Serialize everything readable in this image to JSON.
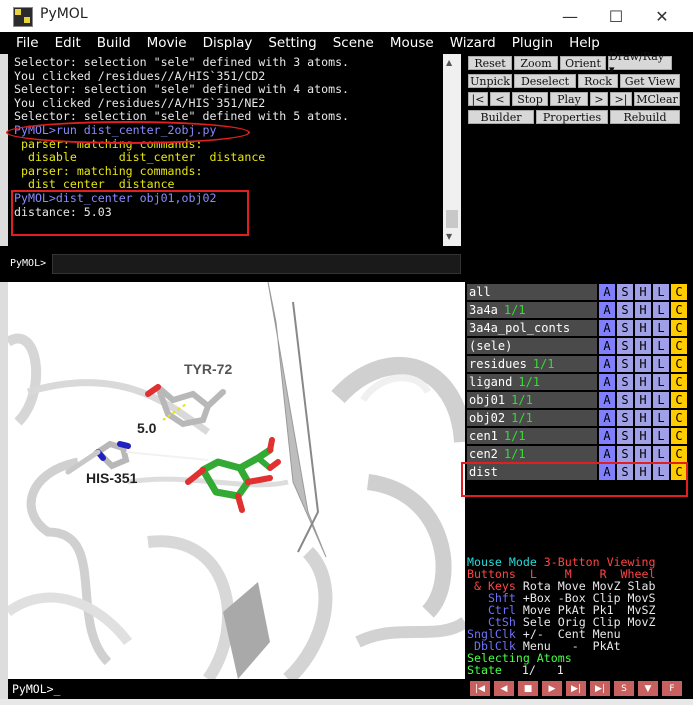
{
  "window": {
    "title": "PyMOL",
    "minimize": "—",
    "maximize": "☐",
    "close": "✕"
  },
  "menu": [
    "File",
    "Edit",
    "Build",
    "Movie",
    "Display",
    "Setting",
    "Scene",
    "Mouse",
    "Wizard",
    "Plugin",
    "Help"
  ],
  "console": {
    "lines": [
      {
        "text": "Selector: selection \"sele\" defined with 3 atoms.",
        "color": "white"
      },
      {
        "text": "You clicked /residues//A/HIS`351/CD2",
        "color": "white"
      },
      {
        "text": "Selector: selection \"sele\" defined with 4 atoms.",
        "color": "white"
      },
      {
        "text": "You clicked /residues//A/HIS`351/NE2",
        "color": "white"
      },
      {
        "text": "Selector: selection \"sele\" defined with 5 atoms.",
        "color": "white"
      },
      {
        "text": "PyMOL>run dist_center_2obj.py",
        "color": "blue"
      },
      {
        "text": " parser: matching commands:",
        "color": "yellow"
      },
      {
        "text": "  disable      dist_center  distance",
        "color": "yellow"
      },
      {
        "text": " parser: matching commands:",
        "color": "yellow"
      },
      {
        "text": "  dist_center  distance",
        "color": "yellow"
      },
      {
        "text": "PyMOL>dist_center obj01,obj02",
        "color": "blue"
      },
      {
        "text": "distance: 5.03",
        "color": "white"
      }
    ]
  },
  "control_buttons": {
    "row1": [
      "Reset",
      "Zoom",
      "Orient",
      "Draw/Ray ▾"
    ],
    "row2": [
      "Unpick",
      "Deselect",
      "Rock",
      "Get View"
    ],
    "row3": [
      "|<",
      "<",
      "Stop",
      "Play",
      ">",
      ">|",
      "MClear"
    ],
    "row4": [
      "Builder",
      "Properties",
      "Rebuild"
    ]
  },
  "command_line": {
    "label": "PyMOL>",
    "value": ""
  },
  "viewer": {
    "labels": {
      "tyr": "TYR-72",
      "his": "HIS-351",
      "distance": "5.0"
    }
  },
  "objects": [
    {
      "name": "all",
      "state": ""
    },
    {
      "name": "3a4a",
      "state": "1/1"
    },
    {
      "name": "3a4a_pol_conts",
      "state": ""
    },
    {
      "name": "(sele)",
      "state": ""
    },
    {
      "name": "residues",
      "state": "1/1"
    },
    {
      "name": "ligand",
      "state": "1/1"
    },
    {
      "name": "obj01",
      "state": "1/1"
    },
    {
      "name": "obj02",
      "state": "1/1"
    },
    {
      "name": "cen1",
      "state": "1/1"
    },
    {
      "name": "cen2",
      "state": "1/1"
    },
    {
      "name": "dist",
      "state": ""
    }
  ],
  "object_buttons": [
    "A",
    "S",
    "H",
    "L",
    "C"
  ],
  "mouse_mode": {
    "title_a": "Mouse Mode ",
    "title_b": "3-Button Viewing",
    "buttons_line": "Buttons  L    M    R  Wheel",
    "keys_line": " & Keys",
    "keys_vals": " Rota Move MovZ Slab",
    "shft": "   Shft",
    "shft_vals": " +Box -Box Clip MovS",
    "ctrl": "   Ctrl",
    "ctrl_vals": " Move PkAt Pk1  MvSZ",
    "ctsh": "   CtSh",
    "ctsh_vals": " Sele Orig Clip MovZ",
    "sngl": "SnglClk",
    "sngl_vals": " +/-  Cent Menu",
    "dbl": " DblClk",
    "dbl_vals": " Menu   -  PkAt",
    "selecting": "Selecting Atoms",
    "state_label": "State",
    "state_value": "1/   1"
  },
  "playback_buttons": [
    "|◀",
    "◀",
    "■",
    "▶",
    "▶|",
    "▶|",
    "S",
    "▼",
    "F"
  ],
  "bottom_command": "PyMOL>_",
  "colors": {
    "highlight": "#e02020",
    "console_blue": "#8a8aff",
    "console_yellow": "#e6e610",
    "state_green": "#33dd33"
  }
}
